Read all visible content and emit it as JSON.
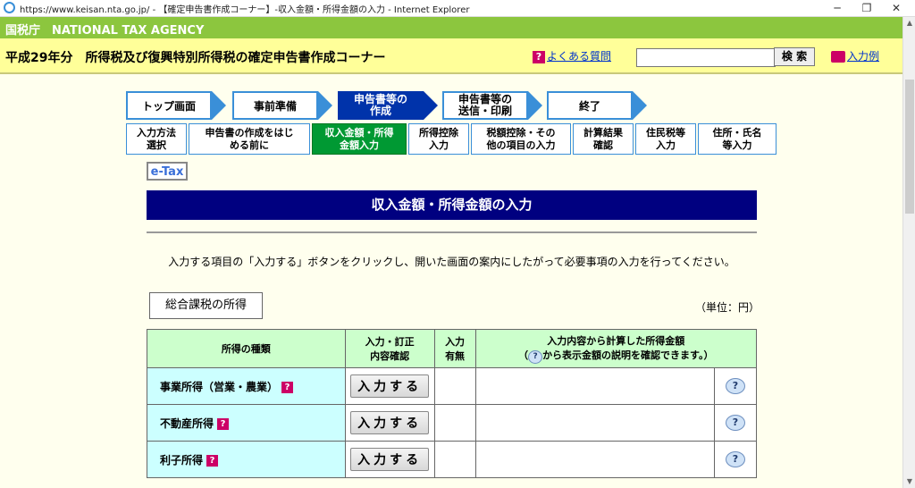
{
  "window": {
    "title": "https://www.keisan.nta.go.jp/ - 【確定申告書作成コーナー】-収入金額・所得金額の入力 - Internet Explorer",
    "minimize": "─",
    "restore": "❐",
    "close": "✕"
  },
  "header": {
    "agency": "国税庁　NATIONAL TAX AGENCY",
    "corner_title": "平成29年分　所得税及び復興特別所得税の確定申告書作成コーナー",
    "faq_label": "よくある質問",
    "search_placeholder": "",
    "search_button": "検 索",
    "example_label": "入力例"
  },
  "steps": {
    "top": "トップ画面",
    "prep": "事前準備",
    "create_l1": "申告書等の",
    "create_l2": "作成",
    "send_l1": "申告書等の",
    "send_l2": "送信・印刷",
    "end": "終了"
  },
  "substeps": {
    "s1_l1": "入力方法",
    "s1_l2": "選択",
    "s2_l1": "申告書の作成をはじ",
    "s2_l2": "める前に",
    "s3_l1": "収入金額・所得",
    "s3_l2": "金額入力",
    "s4_l1": "所得控除",
    "s4_l2": "入力",
    "s5_l1": "税額控除・その",
    "s5_l2": "他の項目の入力",
    "s6_l1": "計算結果",
    "s6_l2": "確認",
    "s7_l1": "住民税等",
    "s7_l2": "入力",
    "s8_l1": "住所・氏名",
    "s8_l2": "等入力"
  },
  "etax_label": "e-Tax",
  "page_title": "収入金額・所得金額の入力",
  "instruction": "入力する項目の「入力する」ボタンをクリックし、開いた画面の案内にしたがって必要事項の入力を行ってください。",
  "section_label": "総合課税の所得",
  "unit_label": "（単位：円）",
  "table": {
    "col_kind": "所得の種類",
    "col_input_l1": "入力・訂正",
    "col_input_l2": "内容確認",
    "col_status_l1": "入力",
    "col_status_l2": "有無",
    "col_amount_l1": "入力内容から計算した所得金額",
    "col_amount_l2_pre": "（",
    "col_amount_l2_post": "から表示金額の説明を確認できます。）",
    "rows": [
      {
        "kind": "事業所得（営業・農業）",
        "button": "入力する"
      },
      {
        "kind": "不動産所得",
        "button": "入力する"
      },
      {
        "kind": "利子所得",
        "button": "入力する"
      }
    ]
  },
  "icons": {
    "question": "?",
    "help": "?"
  },
  "colors": {
    "agency_bar": "#8cc63e",
    "header_bar": "#ffff99",
    "step_active": "#0033aa",
    "substep_active": "#009933",
    "title_bar": "#000080",
    "table_header": "#ccffcc",
    "table_kind": "#ccffff"
  }
}
